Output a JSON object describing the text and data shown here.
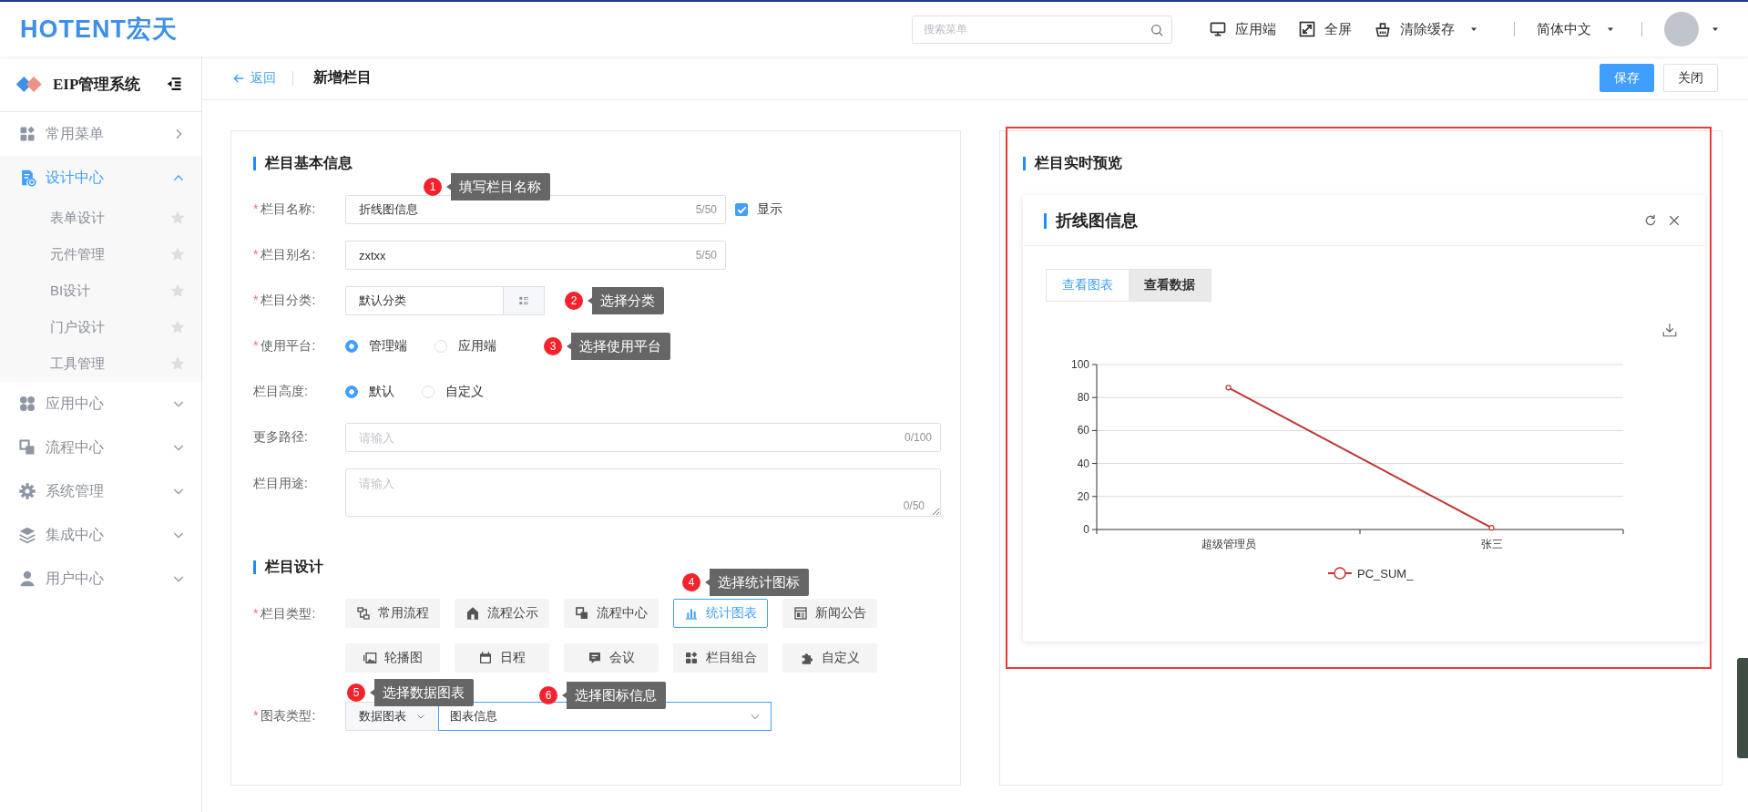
{
  "header": {
    "logo": "HOTENT宏天",
    "search": {
      "placeholder": "搜索菜单"
    },
    "actions": [
      {
        "kind": "client",
        "label": "应用端",
        "dropdown": false
      },
      {
        "kind": "fullscreen",
        "label": "全屏",
        "dropdown": false
      },
      {
        "kind": "cache",
        "label": "清除缓存",
        "dropdown": true
      }
    ],
    "language": "简体中文"
  },
  "sidebar": {
    "title": "EIP管理系统",
    "menu": [
      {
        "kind": "favorites",
        "label": "常用菜单",
        "selected": false,
        "expanded": false,
        "popout": true
      },
      {
        "kind": "design",
        "label": "设计中心",
        "selected": true,
        "expanded": true,
        "popout": false,
        "children": [
          {
            "label": "表单设计",
            "starred": false
          },
          {
            "label": "元件管理",
            "starred": false
          },
          {
            "label": "BI设计",
            "starred": false
          },
          {
            "label": "门户设计",
            "starred": false
          },
          {
            "label": "工具管理",
            "starred": false
          }
        ]
      },
      {
        "kind": "apps",
        "label": "应用中心",
        "selected": false,
        "expanded": false,
        "popout": false
      },
      {
        "kind": "process",
        "label": "流程中心",
        "selected": false,
        "expanded": false,
        "popout": false
      },
      {
        "kind": "system",
        "label": "系统管理",
        "selected": false,
        "expanded": false,
        "popout": false
      },
      {
        "kind": "integration",
        "label": "集成中心",
        "selected": false,
        "expanded": false,
        "popout": false
      },
      {
        "kind": "user",
        "label": "用户中心",
        "selected": false,
        "expanded": false,
        "popout": false
      }
    ]
  },
  "page": {
    "back": "返回",
    "title": "新增栏目",
    "buttons": [
      {
        "label": "保存",
        "primary": true
      },
      {
        "label": "关闭",
        "primary": false
      }
    ]
  },
  "basic": {
    "title": "栏目基本信息",
    "fields": [
      {
        "kind": "text",
        "asterisk": "*",
        "label": "栏目名称:",
        "value": "折线图信息",
        "counter": "5/50",
        "wide": false,
        "checkbox": {
          "label": "显示",
          "checked": true
        },
        "callout": {
          "number": "1",
          "text": "填写栏目名称"
        }
      },
      {
        "kind": "text",
        "asterisk": "*",
        "label": "栏目别名:",
        "value": "zxtxx",
        "counter": "5/50",
        "wide": false
      },
      {
        "kind": "picker",
        "asterisk": "*",
        "label": "栏目分类:",
        "value": "默认分类",
        "callout": {
          "number": "2",
          "text": "选择分类"
        }
      },
      {
        "kind": "radio",
        "asterisk": "*",
        "label": "使用平台:",
        "options": [
          {
            "label": "管理端",
            "selected": true
          },
          {
            "label": "应用端",
            "selected": false
          }
        ],
        "callout": {
          "number": "3",
          "text": "选择使用平台"
        }
      },
      {
        "kind": "radio",
        "label": "栏目高度:",
        "options": [
          {
            "label": "默认",
            "selected": true
          },
          {
            "label": "自定义",
            "selected": false
          }
        ]
      },
      {
        "kind": "text",
        "label": "更多路径:",
        "placeholder": "请输入",
        "counter": "0/100",
        "wide": true
      },
      {
        "kind": "textarea",
        "label": "栏目用途:",
        "placeholder": "请输入",
        "counter": "0/50"
      }
    ]
  },
  "design": {
    "title": "栏目设计",
    "type_field": {
      "asterisk": "*",
      "label": "栏目类型:",
      "types": [
        {
          "kind": "workflow",
          "label": "常用流程",
          "selected": false
        },
        {
          "kind": "announce",
          "label": "流程公示",
          "selected": false
        },
        {
          "kind": "process",
          "label": "流程中心",
          "selected": false
        },
        {
          "kind": "statistics",
          "label": "统计图表",
          "selected": true,
          "callout": {
            "number": "4",
            "text": "选择统计图标"
          }
        },
        {
          "kind": "news",
          "label": "新闻公告",
          "selected": false
        },
        {
          "kind": "carousel",
          "label": "轮播图",
          "selected": false
        },
        {
          "kind": "schedule",
          "label": "日程",
          "selected": false
        },
        {
          "kind": "meeting",
          "label": "会议",
          "selected": false
        },
        {
          "kind": "combo",
          "label": "栏目组合",
          "selected": false
        },
        {
          "kind": "custom",
          "label": "自定义",
          "selected": false
        }
      ]
    },
    "chart_field": {
      "asterisk": "*",
      "label": "图表类型:",
      "category": "数据图表",
      "value": "图表信息",
      "category_callout": {
        "number": "5",
        "text": "选择数据图表"
      },
      "value_callout": {
        "number": "6",
        "text": "选择图标信息"
      }
    }
  },
  "preview": {
    "title": "栏目实时预览",
    "highlighted": true,
    "card": {
      "title": "折线图信息",
      "tabs": [
        {
          "label": "查看图表",
          "selected": true
        },
        {
          "label": "查看数据",
          "selected": false
        }
      ],
      "chart_data": {
        "type": "line",
        "grid": true,
        "categories": [
          "超级管理员",
          "张三"
        ],
        "ylim": [
          0,
          100
        ],
        "yticks": [
          0,
          20,
          40,
          60,
          80,
          100
        ],
        "series": [
          {
            "name": "PC_SUM_",
            "color": "#c23531",
            "marker": "circle",
            "values": [
              86,
              1
            ]
          }
        ]
      }
    }
  }
}
